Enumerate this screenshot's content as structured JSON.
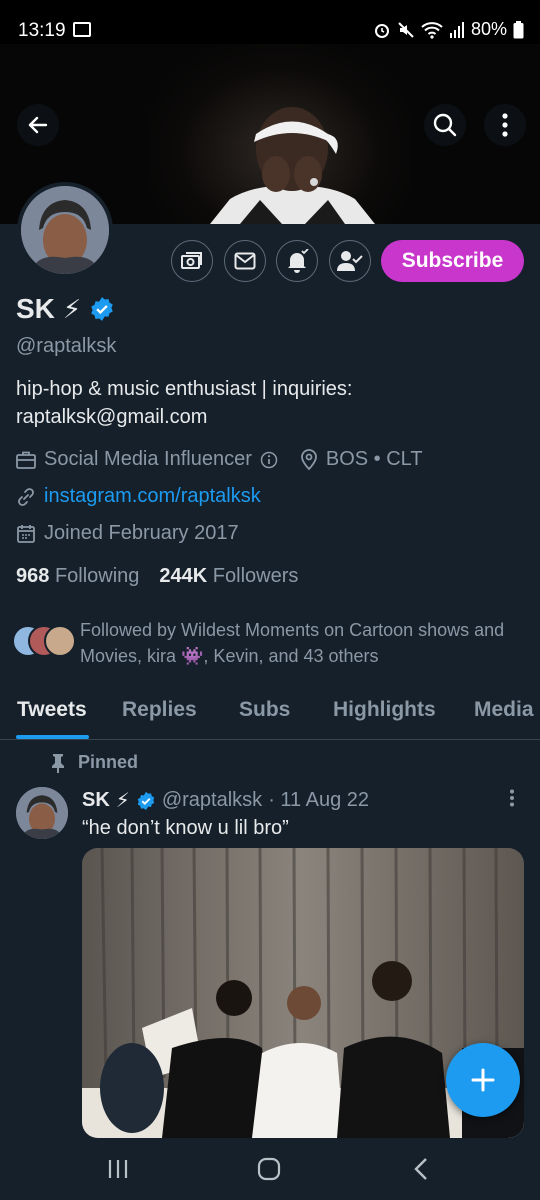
{
  "status_bar": {
    "time": "13:19",
    "battery": "80%"
  },
  "profile": {
    "name": "SK",
    "name_emoji": "⚡",
    "handle": "@raptalksk",
    "bio": "hip-hop & music enthusiast | inquiries: raptalksk@gmail.com",
    "category": "Social Media Influencer",
    "location": "BOS • CLT",
    "website": "instagram.com/raptalksk",
    "joined": "Joined February 2017",
    "following_count": "968",
    "following_label": "Following",
    "followers_count": "244K",
    "followers_label": "Followers",
    "followed_by": "Followed by Wildest Moments on Cartoon shows and Movies, kira 👾, Kevin, and 43 others"
  },
  "actions": {
    "subscribe_label": "Subscribe"
  },
  "tabs": [
    {
      "label": "Tweets",
      "active": true
    },
    {
      "label": "Replies",
      "active": false
    },
    {
      "label": "Subs",
      "active": false
    },
    {
      "label": "Highlights",
      "active": false
    },
    {
      "label": "Media",
      "active": false
    }
  ],
  "pinned_tweet": {
    "pinned_label": "Pinned",
    "name": "SK",
    "name_emoji": "⚡",
    "handle": "@raptalksk",
    "date": "· 11 Aug 22",
    "text": "“he don’t know u lil bro”"
  },
  "icons": {
    "back": "arrow-left-icon",
    "search": "search-icon",
    "more": "more-vertical-icon",
    "subscriptions": "money-icon",
    "message": "envelope-icon",
    "notify": "bell-plus-icon",
    "following": "person-check-icon",
    "verified": "verified-badge-icon",
    "pin": "pin-icon",
    "compose": "plus-icon"
  },
  "colors": {
    "accent": "#1d9bf0",
    "subscribe": "#c936cc",
    "background": "#15202b"
  }
}
